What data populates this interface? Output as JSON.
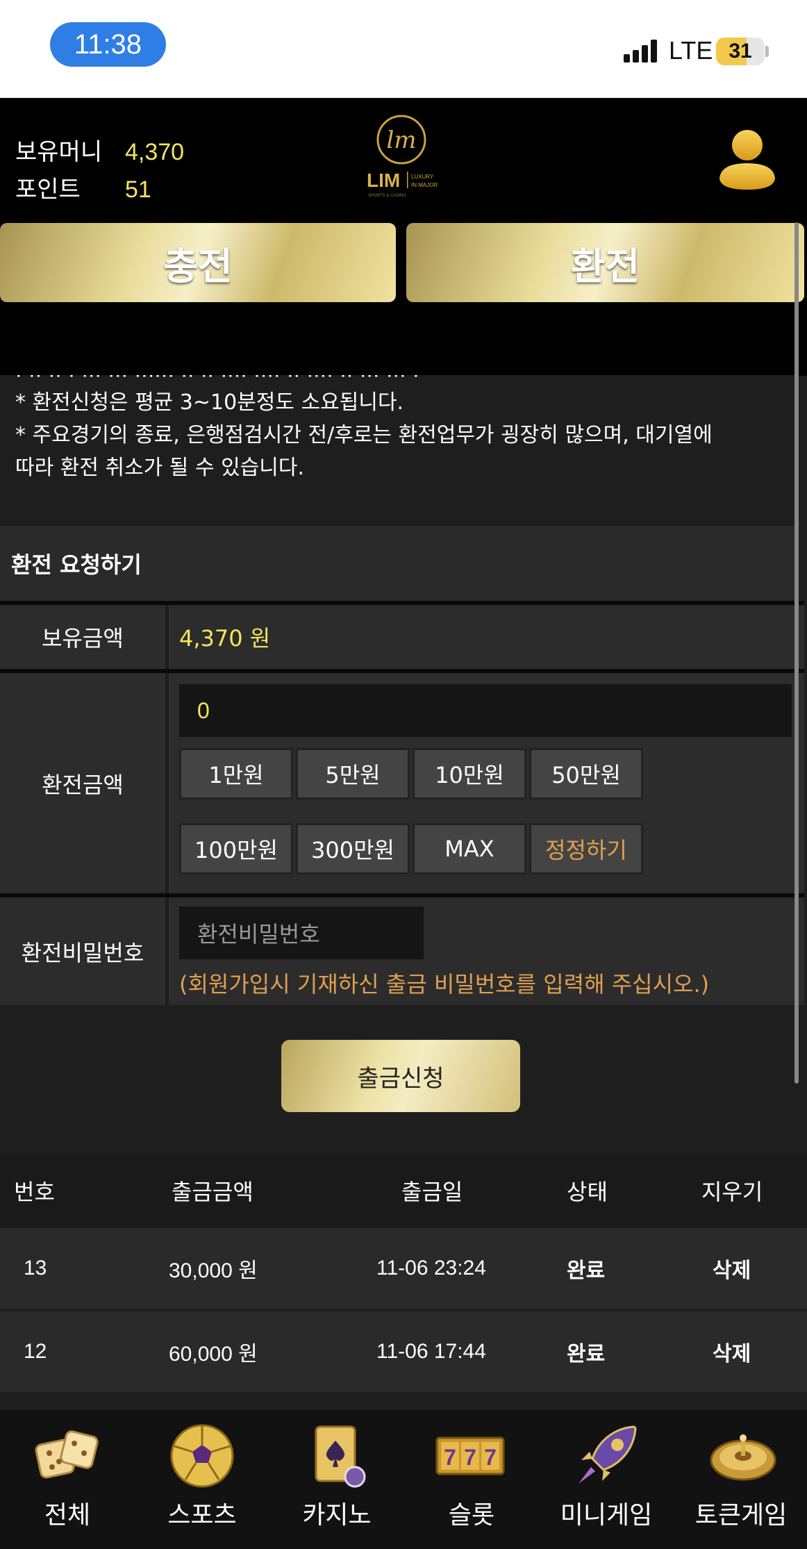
{
  "status_bar": {
    "time": "11:38",
    "network": "LTE",
    "battery": "31"
  },
  "header": {
    "money_label": "보유머니",
    "money_value": "4,370",
    "point_label": "포인트",
    "point_value": "51",
    "logo_text": "LIM",
    "logo_sub": "LUXURY IN MAJOR"
  },
  "tabs": {
    "charge": "충전",
    "exchange": "환전"
  },
  "notice": {
    "line1": "* 환전신청은 평균 3~10분정도 소요됩니다.",
    "line2": "* 주요경기의 종료, 은행점검시간 전/후로는 환전업무가 굉장히 많으며, 대기열에",
    "line3": "따라 환전 취소가 될 수 있습니다."
  },
  "form": {
    "section_title": "환전 요청하기",
    "balance_label": "보유금액",
    "balance_value": "4,370 원",
    "amount_label": "환전금액",
    "amount_value": "0",
    "amount_buttons": [
      "1만원",
      "5만원",
      "10만원",
      "50만원",
      "100만원",
      "300만원",
      "MAX",
      "정정하기"
    ],
    "password_label": "환전비밀번호",
    "password_placeholder": "환전비밀번호",
    "password_hint": "(회원가입시 기재하신 출금 비밀번호를 입력해 주십시오.)",
    "submit": "출금신청"
  },
  "history": {
    "headers": [
      "번호",
      "출금금액",
      "출금일",
      "상태",
      "지우기"
    ],
    "rows": [
      {
        "no": "13",
        "amount": "30,000 원",
        "date": "11-06 23:24",
        "status": "완료",
        "delete": "삭제"
      },
      {
        "no": "12",
        "amount": "60,000 원",
        "date": "11-06 17:44",
        "status": "완료",
        "delete": "삭제"
      }
    ]
  },
  "bottom_nav": [
    {
      "label": "전체",
      "icon": "dice-icon"
    },
    {
      "label": "스포츠",
      "icon": "soccer-ball-icon"
    },
    {
      "label": "카지노",
      "icon": "cards-icon"
    },
    {
      "label": "슬롯",
      "icon": "slot-777-icon"
    },
    {
      "label": "미니게임",
      "icon": "rocket-icon"
    },
    {
      "label": "토큰게임",
      "icon": "roulette-icon"
    }
  ],
  "colors": {
    "accent_yellow": "#f5e65b",
    "gold": "#d9c77f",
    "hint_orange": "#e0a050",
    "background": "#1e1e1e"
  }
}
